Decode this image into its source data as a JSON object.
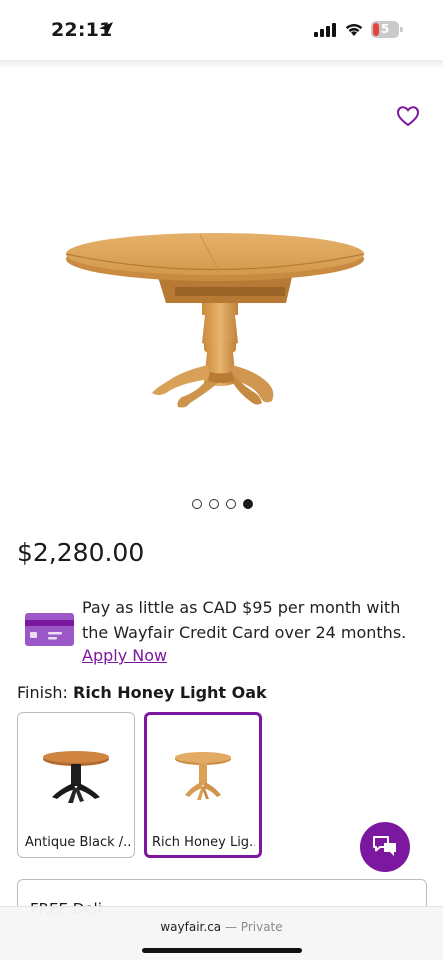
{
  "status_bar": {
    "time": "22:11",
    "battery_level": "5"
  },
  "product": {
    "price": "$2,280.00",
    "image_count": 4,
    "active_image_index": 4
  },
  "credit": {
    "text": "Pay as little as CAD $95 per month with the Wayfair Credit Card over 24 months.",
    "apply_label": "Apply Now"
  },
  "finish": {
    "label": "Finish:",
    "value": "Rich Honey Light Oak",
    "options": [
      {
        "label": "Antique Black /...",
        "selected": false
      },
      {
        "label": "Rich Honey Lig...",
        "selected": true
      }
    ]
  },
  "delivery": {
    "text": "FREE Deli..."
  },
  "browser": {
    "domain": "wayfair.ca",
    "separator": "—",
    "mode": "Private"
  },
  "colors": {
    "brand_purple": "#7b189f",
    "wood": "#dca35a"
  }
}
